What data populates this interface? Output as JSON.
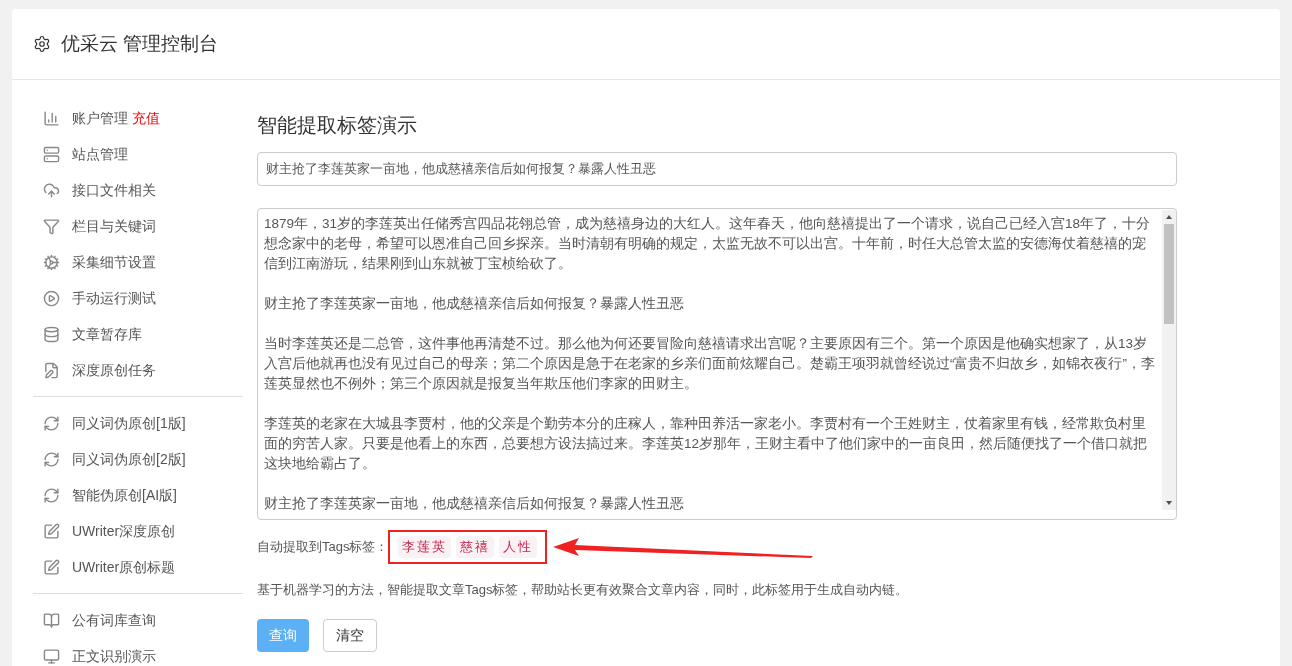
{
  "header": {
    "title": "优采云 管理控制台"
  },
  "sidebar": {
    "groups": [
      {
        "items": [
          {
            "label": "账户管理",
            "badge": "充值"
          },
          {
            "label": "站点管理"
          },
          {
            "label": "接口文件相关"
          },
          {
            "label": "栏目与关键词"
          },
          {
            "label": "采集细节设置"
          },
          {
            "label": "手动运行测试"
          },
          {
            "label": "文章暂存库"
          },
          {
            "label": "深度原创任务"
          }
        ]
      },
      {
        "items": [
          {
            "label": "同义词伪原创[1版]"
          },
          {
            "label": "同义词伪原创[2版]"
          },
          {
            "label": "智能伪原创[AI版]"
          },
          {
            "label": "UWriter深度原创"
          },
          {
            "label": "UWriter原创标题"
          }
        ]
      },
      {
        "items": [
          {
            "label": "公有词库查询"
          },
          {
            "label": "正文识别演示"
          }
        ]
      }
    ]
  },
  "main": {
    "title": "智能提取标签演示",
    "title_field": {
      "value": "财主抢了李莲英家一亩地，他成慈禧亲信后如何报复？暴露人性丑恶"
    },
    "content_field": {
      "paragraphs": [
        "1879年，31岁的李莲英出任储秀宫四品花翎总管，成为慈禧身边的大红人。这年春天，他向慈禧提出了一个请求，说自己已经入宫18年了，十分想念家中的老母，希望可以恩准自己回乡探亲。当时清朝有明确的规定，太监无故不可以出宫。十年前，时任大总管太监的安德海仗着慈禧的宠信到江南游玩，结果刚到山东就被丁宝桢给砍了。",
        "财主抢了李莲英家一亩地，他成慈禧亲信后如何报复？暴露人性丑恶",
        "当时李莲英还是二总管，这件事他再清楚不过。那么他为何还要冒险向慈禧请求出宫呢？主要原因有三个。第一个原因是他确实想家了，从13岁入宫后他就再也没有见过自己的母亲；第二个原因是急于在老家的乡亲们面前炫耀自己。楚霸王项羽就曾经说过“富贵不归故乡，如锦衣夜行”，李莲英显然也不例外；第三个原因就是报复当年欺压他们李家的田财主。",
        "李莲英的老家在大城县李贾村，他的父亲是个勤劳本分的庄稼人，靠种田养活一家老小。李贾村有一个王姓财主，仗着家里有钱，经常欺负村里面的穷苦人家。只要是他看上的东西，总要想方设法搞过来。李莲英12岁那年，王财主看中了他们家中的一亩良田，然后随便找了一个借口就把这块地给霸占了。",
        "财主抢了李莲英家一亩地，他成慈禧亲信后如何报复？暴露人性丑恶"
      ]
    },
    "tags_label": "自动提取到Tags标签：",
    "tags": [
      "李莲英",
      "慈禧",
      "人性"
    ],
    "tags_highlighted": true,
    "description": "基于机器学习的方法，智能提取文章Tags标签，帮助站长更有效聚合文章内容，同时，此标签用于生成自动内链。",
    "buttons": [
      {
        "label": "查询",
        "kind": "primary"
      },
      {
        "label": "清空",
        "kind": "default"
      }
    ]
  }
}
